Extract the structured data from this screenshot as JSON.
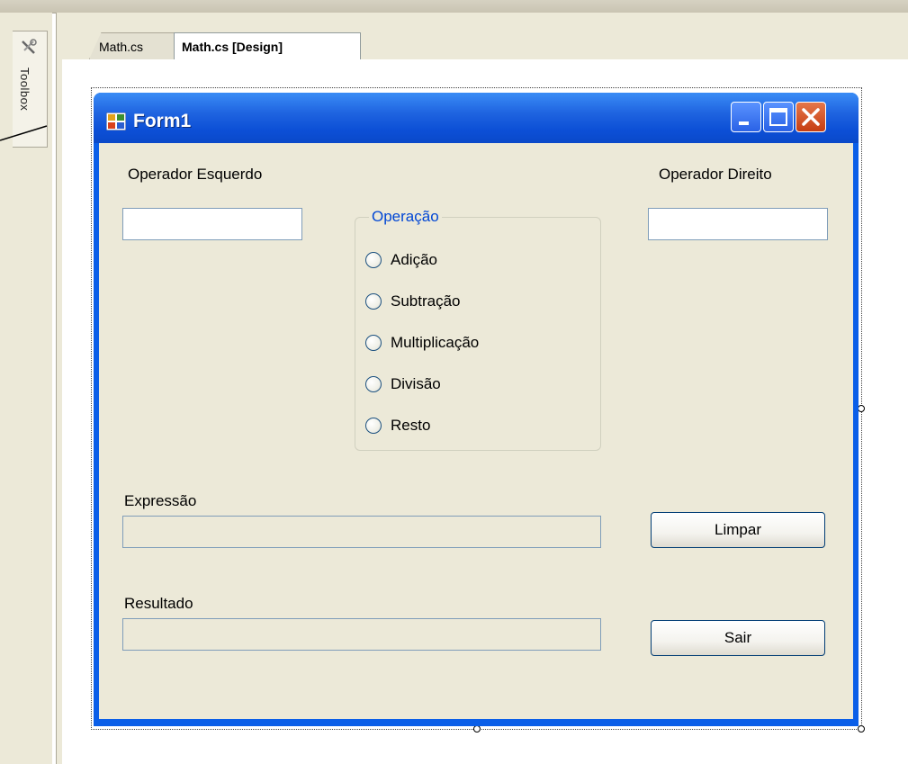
{
  "ide": {
    "toolbox_label": "Toolbox",
    "tabs": [
      {
        "label": "Math.cs",
        "active": false
      },
      {
        "label": "Math.cs [Design]",
        "active": true
      }
    ]
  },
  "form": {
    "title": "Form1",
    "labels": {
      "left_operand": "Operador  Esquerdo",
      "right_operand": "Operador Direito",
      "expression": "Expressão",
      "result": "Resultado"
    },
    "fields": {
      "left_operand_value": "",
      "right_operand_value": "",
      "expression_value": "",
      "result_value": ""
    },
    "group": {
      "title": "Operação",
      "options": [
        "Adição",
        "Subtração",
        "Multiplicação",
        "Divisão",
        "Resto"
      ]
    },
    "buttons": {
      "clear": "Limpar",
      "exit": "Sair"
    }
  },
  "colors": {
    "titlebar": "#0a49c9",
    "client_bg": "#ece9d8",
    "group_title": "#0046d5",
    "close_button": "#c63d12"
  }
}
